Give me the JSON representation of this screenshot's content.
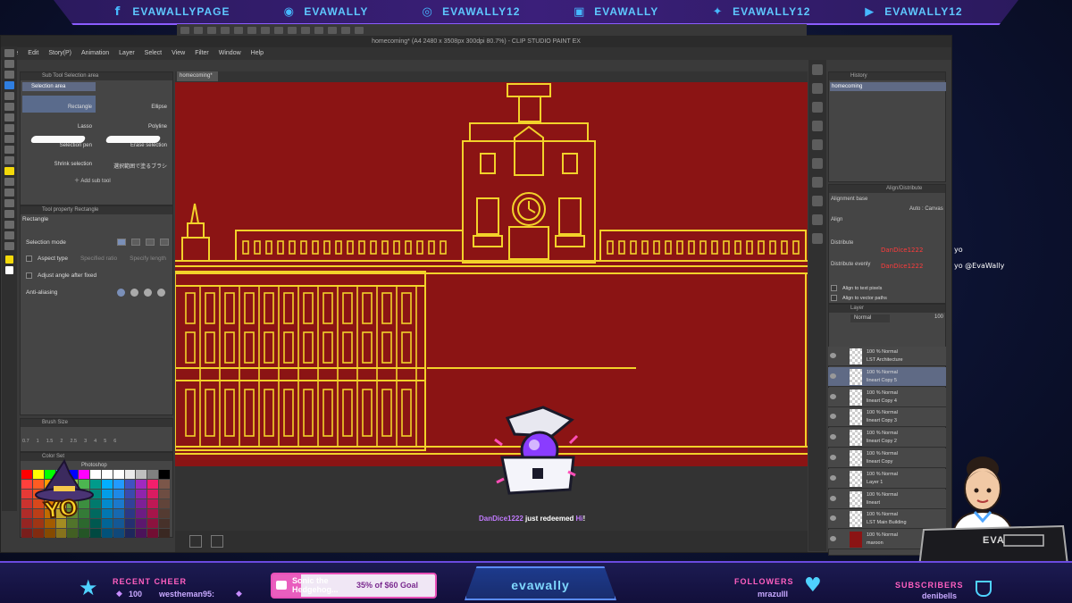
{
  "social": [
    {
      "icon": "facebook-icon",
      "glyph": "f",
      "label": "EVAWALLYPAGE"
    },
    {
      "icon": "discord-icon",
      "glyph": "◉",
      "label": "EVAWALLY"
    },
    {
      "icon": "instagram-icon",
      "glyph": "◎",
      "label": "EVAWALLY12"
    },
    {
      "icon": "twitch-icon",
      "glyph": "▣",
      "label": "EVAWALLY"
    },
    {
      "icon": "twitter-icon",
      "glyph": "✦",
      "label": "EVAWALLY12"
    },
    {
      "icon": "youtube-icon",
      "glyph": "▶",
      "label": "EVAWALLY12"
    }
  ],
  "app": {
    "title": "homecoming* (A4 2480 x 3508px 300dpi 80.7%) - CLIP STUDIO PAINT EX",
    "menu": [
      "File",
      "Edit",
      "Story(P)",
      "Animation",
      "Layer",
      "Select",
      "View",
      "Filter",
      "Window",
      "Help"
    ],
    "doc_tab": "homecoming*"
  },
  "subtool": {
    "panel_title": "Sub Tool Selection area",
    "group": "Selection area",
    "items": [
      "Rectangle",
      "Ellipse",
      "Lasso",
      "Polyline",
      "Selection pen",
      "Erase selection",
      "Shrink selection",
      "選択範囲で塗るブラシ"
    ],
    "add": "Add sub tool"
  },
  "tool_property": {
    "panel_title": "Tool property Rectangle",
    "name": "Rectangle",
    "selection_mode": "Selection mode",
    "aspect_type": "Aspect type",
    "specified_ratio": "Specified ratio",
    "specify_length": "Specify length",
    "adjust_angle": "Adjust angle after fixed",
    "anti_aliasing": "Anti-aliasing"
  },
  "brush_size": {
    "panel_title": "Brush Size",
    "values": [
      "0.7",
      "1",
      "1.5",
      "2",
      "2.5",
      "3",
      "4",
      "5",
      "6"
    ]
  },
  "color_set": {
    "panel_title": "Color Set",
    "set_name": "Photoshop"
  },
  "history": {
    "panel_title": "History",
    "item": "homecoming"
  },
  "align": {
    "panel_title": "Align/Distribute",
    "alignment_base": "Alignment base",
    "auto_canvas": "Auto : Canvas",
    "align": "Align",
    "distribute": "Distribute",
    "distribute_evenly": "Distribute evenly",
    "align_pixels": "Align to text pixels",
    "align_vector": "Align to vector paths"
  },
  "layer_panel": {
    "panel_title": "Layer",
    "blend_mode": "Normal",
    "opacity": "100",
    "layers": [
      {
        "mode": "100 % Normal",
        "name": "LST Architecture"
      },
      {
        "mode": "100 % Normal",
        "name": "lineart Copy 5"
      },
      {
        "mode": "100 % Normal",
        "name": "lineart Copy 4"
      },
      {
        "mode": "100 % Normal",
        "name": "lineart Copy 3"
      },
      {
        "mode": "100 % Normal",
        "name": "lineart Copy 2"
      },
      {
        "mode": "100 % Normal",
        "name": "lineart Copy"
      },
      {
        "mode": "100 % Normal",
        "name": "Layer 1"
      },
      {
        "mode": "100 % Normal",
        "name": "lineart"
      },
      {
        "mode": "100 % Normal",
        "name": "LST Main Building"
      },
      {
        "mode": "100 % Normal",
        "name": "maroon"
      }
    ]
  },
  "chat": {
    "line1": "yo",
    "line2": "yo @EvaWally",
    "name1": "DanDice1222",
    "name2": "DanDice1222"
  },
  "alert": {
    "user": "DanDice1222",
    "action": "just redeemed",
    "item": "Hi",
    "tail": "!"
  },
  "overlay_yo": "YO",
  "bottom": {
    "recent_cheer_label": "RECENT CHEER",
    "cheer_amount": "100",
    "cheer_user": "westheman95:",
    "goal_title": "Sonic the Hedgehog...",
    "goal_text": "35% of $60 Goal",
    "channel": "evawally",
    "followers_label": "FOLLOWERS",
    "follower_name": "mrazulll",
    "subscribers_label": "SUBSCRIBERS",
    "subscriber_name": "denibells",
    "tablet_label": "EVA"
  },
  "colors": {
    "canvas": "#8b1414",
    "lineart": "#f2d22a",
    "accent": "#8b5cff",
    "social_text": "#5ec8ff",
    "pink": "#ff4fb8"
  }
}
